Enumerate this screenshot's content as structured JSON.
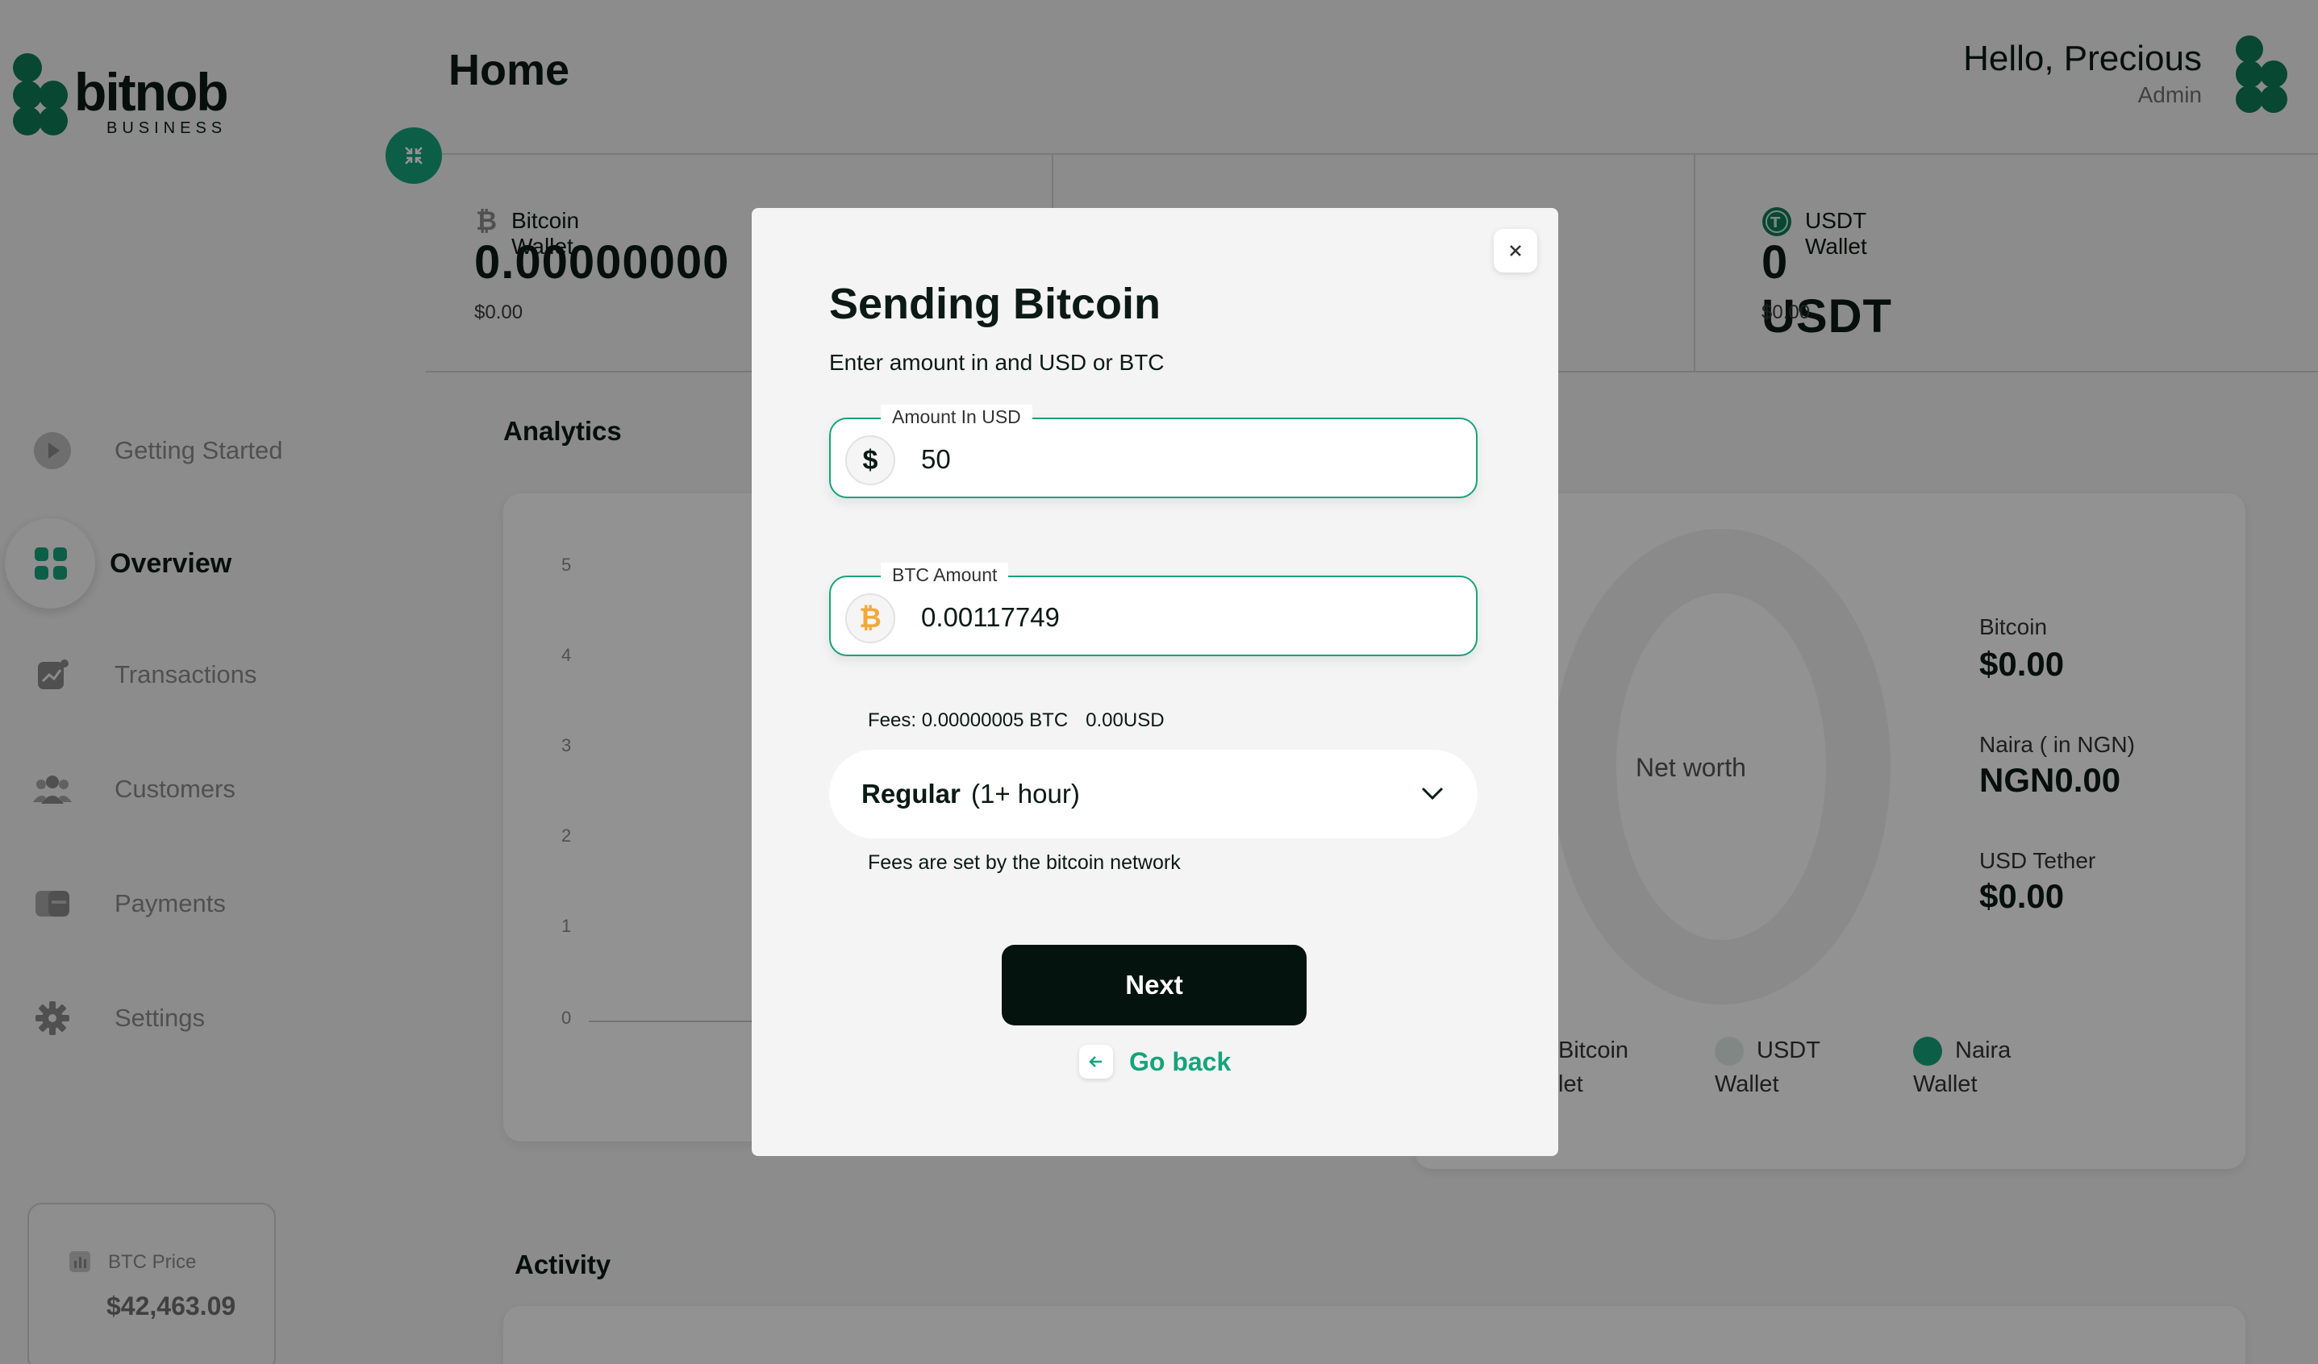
{
  "brand": {
    "name": "bitnob",
    "sub": "BUSINESS",
    "accent": "#16a37a",
    "dark": "#04130e"
  },
  "header": {
    "title": "Home",
    "greeting": "Hello, Precious",
    "role": "Admin"
  },
  "sidebar": {
    "items": [
      {
        "label": "Getting Started",
        "icon": "play-icon"
      },
      {
        "label": "Overview",
        "icon": "grid-icon",
        "active": true
      },
      {
        "label": "Transactions",
        "icon": "chart-icon"
      },
      {
        "label": "Customers",
        "icon": "users-icon"
      },
      {
        "label": "Payments",
        "icon": "cards-icon"
      },
      {
        "label": "Settings",
        "icon": "gear-icon"
      }
    ],
    "btc_price": {
      "label": "BTC Price",
      "value": "$42,463.09"
    }
  },
  "wallets": [
    {
      "name": "Bitcoin Wallet",
      "amount": "0.00000000",
      "usd": "$0.00"
    },
    {
      "name": "USDT Wallet",
      "amount": "0 USDT",
      "usd": "$0.00"
    }
  ],
  "analytics": {
    "title": "Analytics",
    "ticks": [
      "5",
      "4",
      "3",
      "2",
      "1",
      "0"
    ]
  },
  "networth": {
    "center": "Net worth",
    "rows": [
      {
        "label": "Bitcoin",
        "value": "$0.00"
      },
      {
        "label": "Naira ( in NGN)",
        "value": "NGN0.00"
      },
      {
        "label": "USD Tether",
        "value": "$0.00"
      }
    ],
    "legend": [
      {
        "line1": "Bitcoin",
        "line2": "let"
      },
      {
        "line1": "USDT",
        "line2": "Wallet"
      },
      {
        "line1": "Naira",
        "line2": "Wallet"
      }
    ]
  },
  "activity": {
    "title": "Activity"
  },
  "modal": {
    "title": "Sending Bitcoin",
    "subtitle": "Enter amount in and USD or BTC",
    "usd_field": {
      "legend": "Amount In USD",
      "symbol": "$",
      "value": "50"
    },
    "btc_field": {
      "legend": "BTC Amount",
      "symbol": "₿",
      "value": "0.00117749"
    },
    "fees": {
      "btc": "Fees: 0.00000005 BTC",
      "usd": "0.00USD"
    },
    "speed": {
      "label": "Regular",
      "eta": "(1+ hour)"
    },
    "fees_note": "Fees are set by the bitcoin network",
    "next_label": "Next",
    "back_label": "Go back"
  }
}
